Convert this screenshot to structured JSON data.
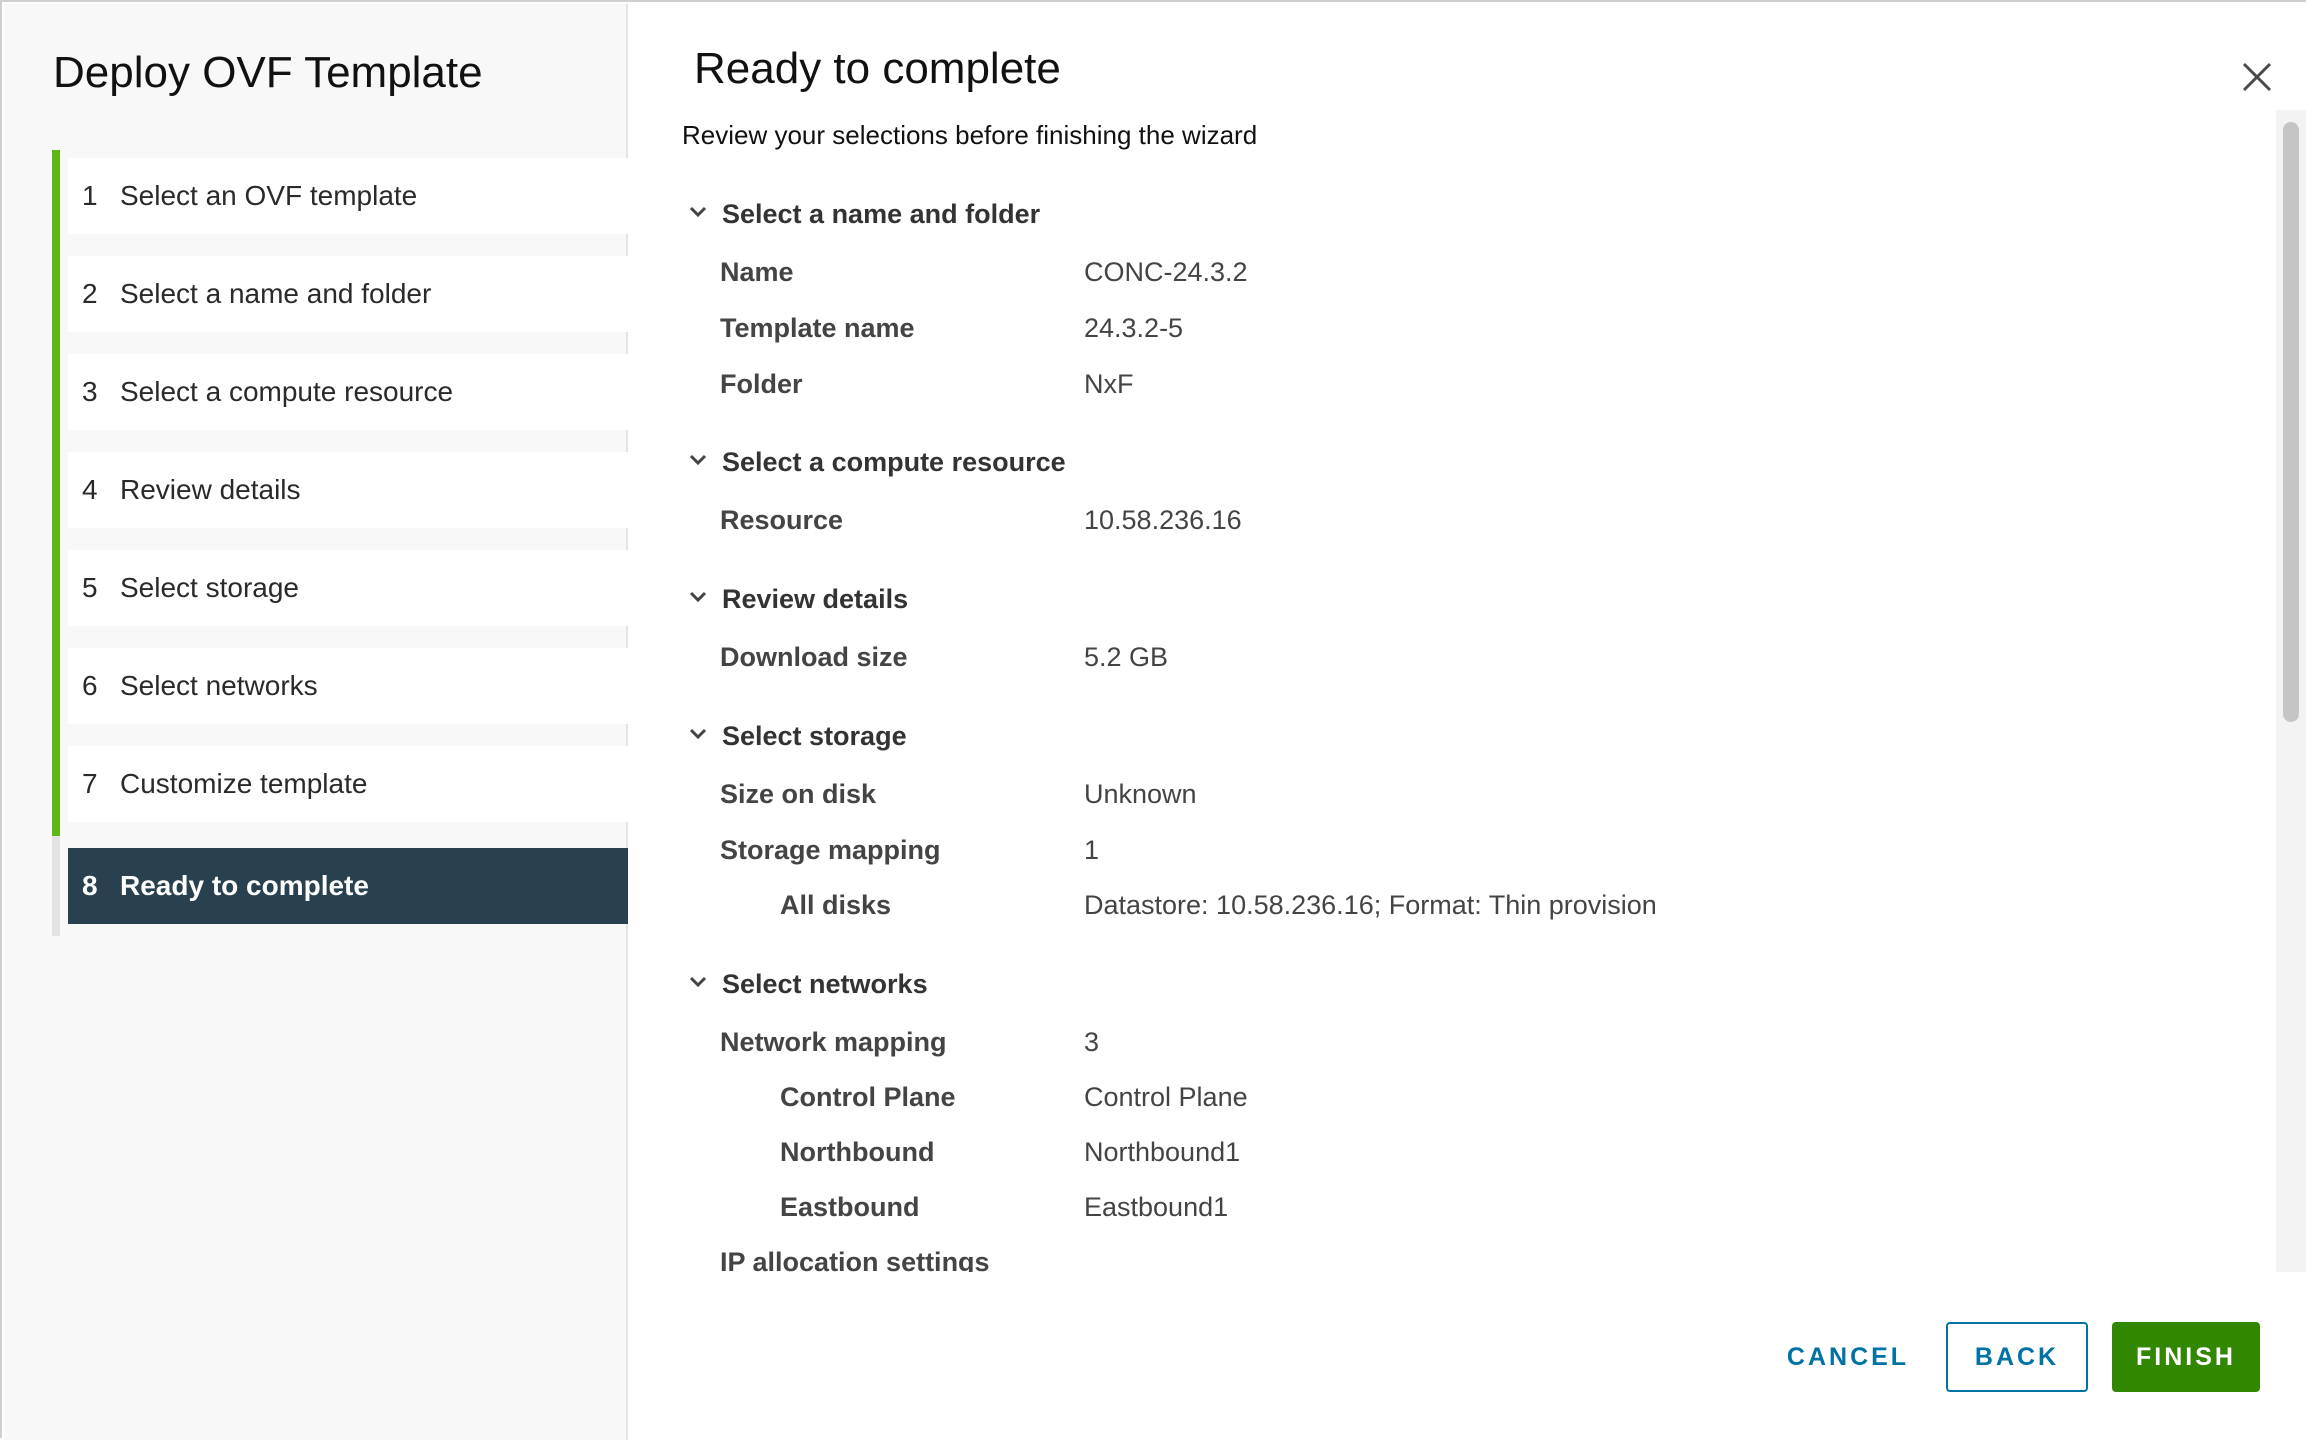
{
  "dialog": {
    "title": "Deploy OVF Template"
  },
  "steps": [
    {
      "num": "1",
      "label": "Select an OVF template",
      "state": "completed"
    },
    {
      "num": "2",
      "label": "Select a name and folder",
      "state": "completed"
    },
    {
      "num": "3",
      "label": "Select a compute resource",
      "state": "completed"
    },
    {
      "num": "4",
      "label": "Review details",
      "state": "completed"
    },
    {
      "num": "5",
      "label": "Select storage",
      "state": "completed"
    },
    {
      "num": "6",
      "label": "Select networks",
      "state": "completed"
    },
    {
      "num": "7",
      "label": "Customize template",
      "state": "completed"
    },
    {
      "num": "8",
      "label": "Ready to complete",
      "state": "active"
    }
  ],
  "main": {
    "title": "Ready to complete",
    "subtitle": "Review your selections before finishing the wizard"
  },
  "sections": {
    "name_folder": {
      "heading": "Select a name and folder",
      "rows": [
        {
          "key": "Name",
          "value": "CONC-24.3.2"
        },
        {
          "key": "Template name",
          "value": "24.3.2-5"
        },
        {
          "key": "Folder",
          "value": "NxF"
        }
      ]
    },
    "compute": {
      "heading": "Select a compute resource",
      "rows": [
        {
          "key": "Resource",
          "value": "10.58.236.16"
        }
      ]
    },
    "review": {
      "heading": "Review details",
      "rows": [
        {
          "key": "Download size",
          "value": "5.2 GB"
        }
      ]
    },
    "storage": {
      "heading": "Select storage",
      "rows": [
        {
          "key": "Size on disk",
          "value": "Unknown"
        },
        {
          "key": "Storage mapping",
          "value": "1"
        },
        {
          "key": "All disks",
          "value": "Datastore: 10.58.236.16; Format: Thin provision"
        }
      ]
    },
    "networks": {
      "heading": "Select networks",
      "rows": [
        {
          "key": "Network mapping",
          "value": "3"
        },
        {
          "key": "Control Plane",
          "value": "Control Plane"
        },
        {
          "key": "Northbound",
          "value": "Northbound1"
        },
        {
          "key": "Eastbound",
          "value": "Eastbound1"
        },
        {
          "key": "IP allocation settings",
          "value": ""
        }
      ]
    }
  },
  "footer": {
    "cancel": "CANCEL",
    "back": "BACK",
    "finish": "FINISH"
  },
  "colors": {
    "progress": "#60b515",
    "active_step": "#29414e",
    "link": "#0072a3",
    "finish": "#318700"
  },
  "icons": {
    "close": "close-icon",
    "chevron": "chevron-down-icon"
  }
}
